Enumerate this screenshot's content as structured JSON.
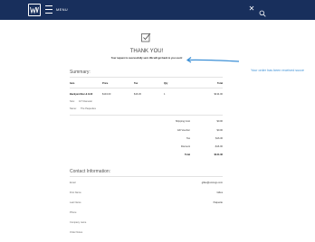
{
  "header": {
    "menu_label": "MENU",
    "logo_icon": "brand-logo",
    "close_icon": "close-icon",
    "search_icon": "search-icon"
  },
  "confirmation": {
    "title": "THANK YOU!",
    "message": "Your request is successfully sent. We will get back to you soon!",
    "icon": "checkbox-icon"
  },
  "annotation": {
    "text": "Your order has been received succe",
    "color": "#3b8fd6"
  },
  "summary": {
    "title": "Summary:",
    "columns": [
      "Item",
      "Price",
      "Tax",
      "Qty",
      "Total"
    ],
    "rows": [
      {
        "item": "Backyard Bar & Grill",
        "price": "$134.00",
        "tax": "$16.36",
        "qty": "1",
        "total": "$134.00",
        "options": [
          {
            "label": "Size:",
            "value": "10\" Diameter"
          },
          {
            "label": "Name:",
            "value": "The Paquettes"
          }
        ]
      }
    ],
    "totals": [
      {
        "label": "Shipping Cost",
        "value": "$0.00"
      },
      {
        "label": "Gift Voucher",
        "value": "$0.00"
      },
      {
        "label": "Tax",
        "value": "$16.36"
      },
      {
        "label": "Discount",
        "value": "-$16.00"
      },
      {
        "label": "Total",
        "value": "$134.36"
      }
    ]
  },
  "contact": {
    "title": "Contact Information:",
    "fields": [
      {
        "label": "Email",
        "value": "gilles@uniongs.com"
      },
      {
        "label": "First Name",
        "value": "Gilles"
      },
      {
        "label": "Last Name",
        "value": "Paquette"
      },
      {
        "label": "Phone",
        "value": ""
      },
      {
        "label": "Company name",
        "value": ""
      },
      {
        "label": "Order Notes",
        "value": ""
      }
    ]
  },
  "colors": {
    "topbar": "#182f5c",
    "accent": "#3b8fd6"
  }
}
